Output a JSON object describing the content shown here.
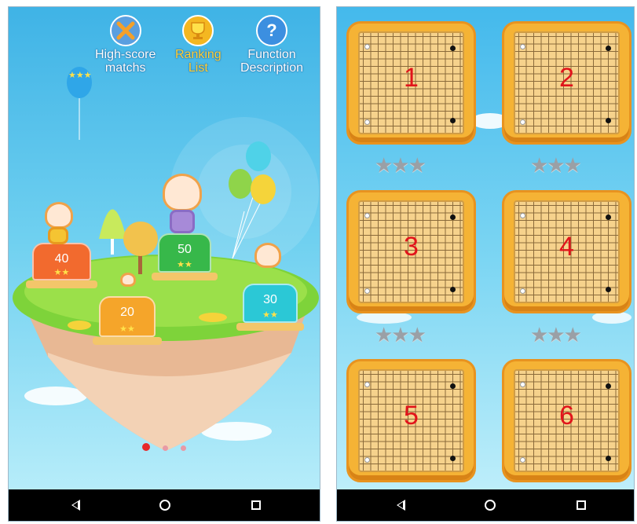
{
  "left_screen": {
    "menu": [
      {
        "label": "High-score\nmatchs",
        "icon": "crossed-swords-icon",
        "color": "#5a9fe0"
      },
      {
        "label": "Ranking\nList",
        "icon": "trophy-icon",
        "color": "#f4b721"
      },
      {
        "label": "Function\nDescription",
        "icon": "question-icon",
        "color": "#3c8fe0",
        "glyph": "?"
      }
    ],
    "pedestals": [
      {
        "value": "40",
        "stars": "★★",
        "color": "#f26a2e"
      },
      {
        "value": "50",
        "stars": "★★",
        "color": "#37b84a"
      },
      {
        "value": "20",
        "stars": "★★",
        "color": "#f5a52a"
      },
      {
        "value": "30",
        "stars": "★★",
        "color": "#2bc8d6"
      }
    ],
    "balloon_stars": "★★★",
    "pager": {
      "pages": 3,
      "active": 0
    }
  },
  "right_screen": {
    "levels": [
      {
        "number": "1",
        "stars": "★★★"
      },
      {
        "number": "2",
        "stars": "★★★"
      },
      {
        "number": "3",
        "stars": "★★★"
      },
      {
        "number": "4",
        "stars": "★★★"
      },
      {
        "number": "5",
        "stars": ""
      },
      {
        "number": "6",
        "stars": ""
      }
    ]
  },
  "navbar": {
    "back": "back-icon",
    "home": "home-icon",
    "recents": "recents-icon"
  }
}
